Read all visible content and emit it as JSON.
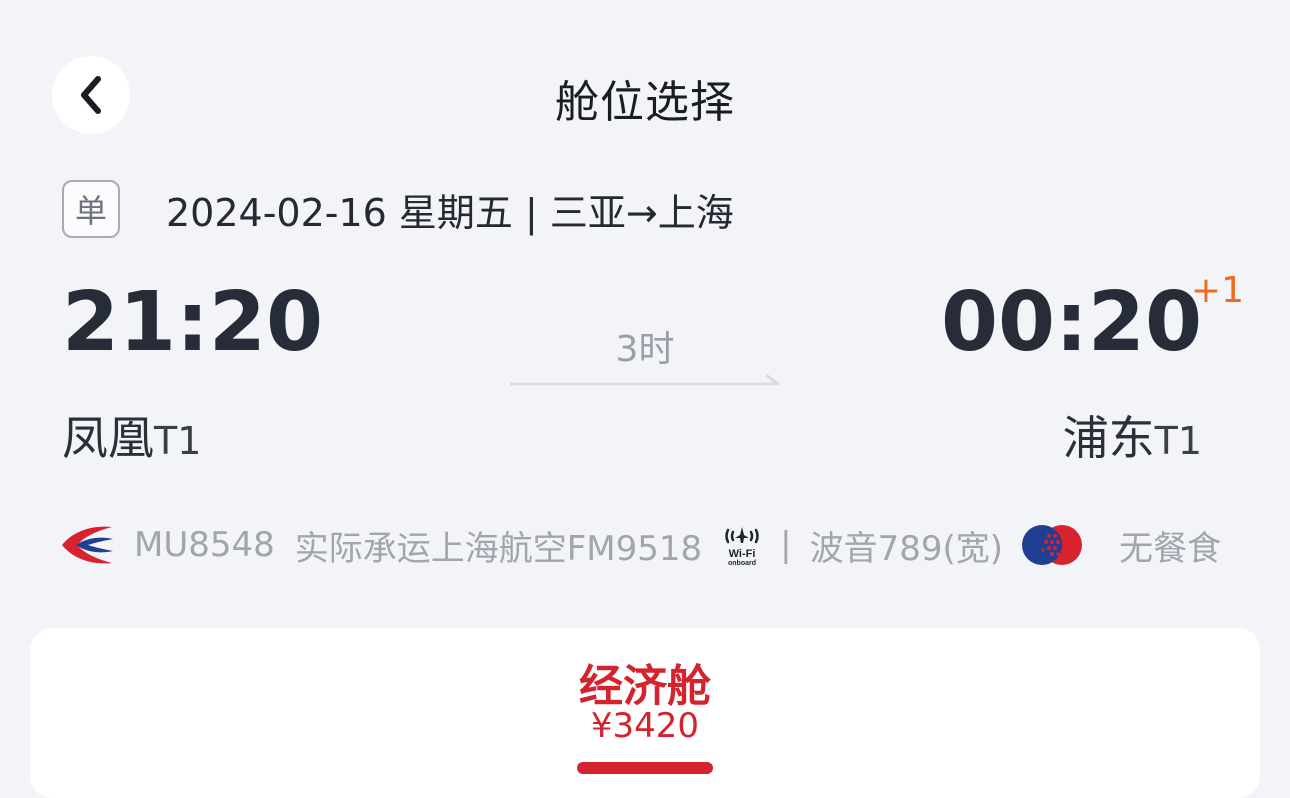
{
  "header": {
    "title": "舱位选择",
    "back_icon": "chevron-left-icon"
  },
  "trip": {
    "badge": "单",
    "summary": "2024-02-16 星期五 | 三亚→上海"
  },
  "flight": {
    "departure_time": "21:20",
    "arrival_time": "00:20",
    "arrival_day_offset": "+1",
    "duration": "3时",
    "departure_airport": "凤凰",
    "departure_terminal": "T1",
    "arrival_airport": "浦东",
    "arrival_terminal": "T1"
  },
  "details": {
    "airline_logo": "china-eastern-logo",
    "flight_number": "MU8548",
    "codeshare": "实际承运上海航空FM9518",
    "wifi_icon": "wifi-onboard-icon",
    "wifi_label": "Wi-Fi",
    "wifi_sublabel": "onboard",
    "separator": "|",
    "aircraft": "波音789(宽)",
    "meal_icon": "meal-badge-icon",
    "meal": "无餐食"
  },
  "cabin": {
    "name": "经济舱",
    "price": "¥3420"
  },
  "colors": {
    "accent": "#d2232e",
    "day_offset": "#ee6b22",
    "background": "#f3f4f8"
  }
}
